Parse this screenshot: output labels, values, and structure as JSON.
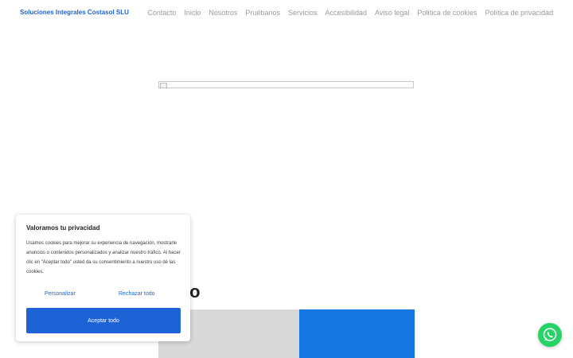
{
  "header": {
    "brand": "Soluciones Integrales Costasol SLU",
    "nav": [
      "Contacto",
      "Inicio",
      "Nosotros",
      "Pruébanos",
      "Servicios",
      "Accesibilidad",
      "Aviso legal",
      "Política de cookies",
      "Política de privacidad"
    ]
  },
  "main": {
    "heading_partial": "io"
  },
  "cookie_banner": {
    "title": "Valoramos tu privacidad",
    "body": "Usamos cookies para mejorar su experiencia de navegación, mostrarle anuncios o contenidos personalizados y analizar nuestro tráfico. Al hacer clic en \"Aceptar todo\" usted da su consentimiento a nuestro uso de las cookies.",
    "customize_label": "Personalizar",
    "reject_label": "Rechazar todo",
    "accept_label": "Aceptar todo"
  },
  "colors": {
    "accent": "#1e63d6",
    "blue_block": "#1476e0",
    "gray_block": "#d9d9d9",
    "whatsapp": "#25d366"
  },
  "icons": {
    "floating": "whatsapp-icon",
    "broken_image": "broken-image-icon"
  }
}
